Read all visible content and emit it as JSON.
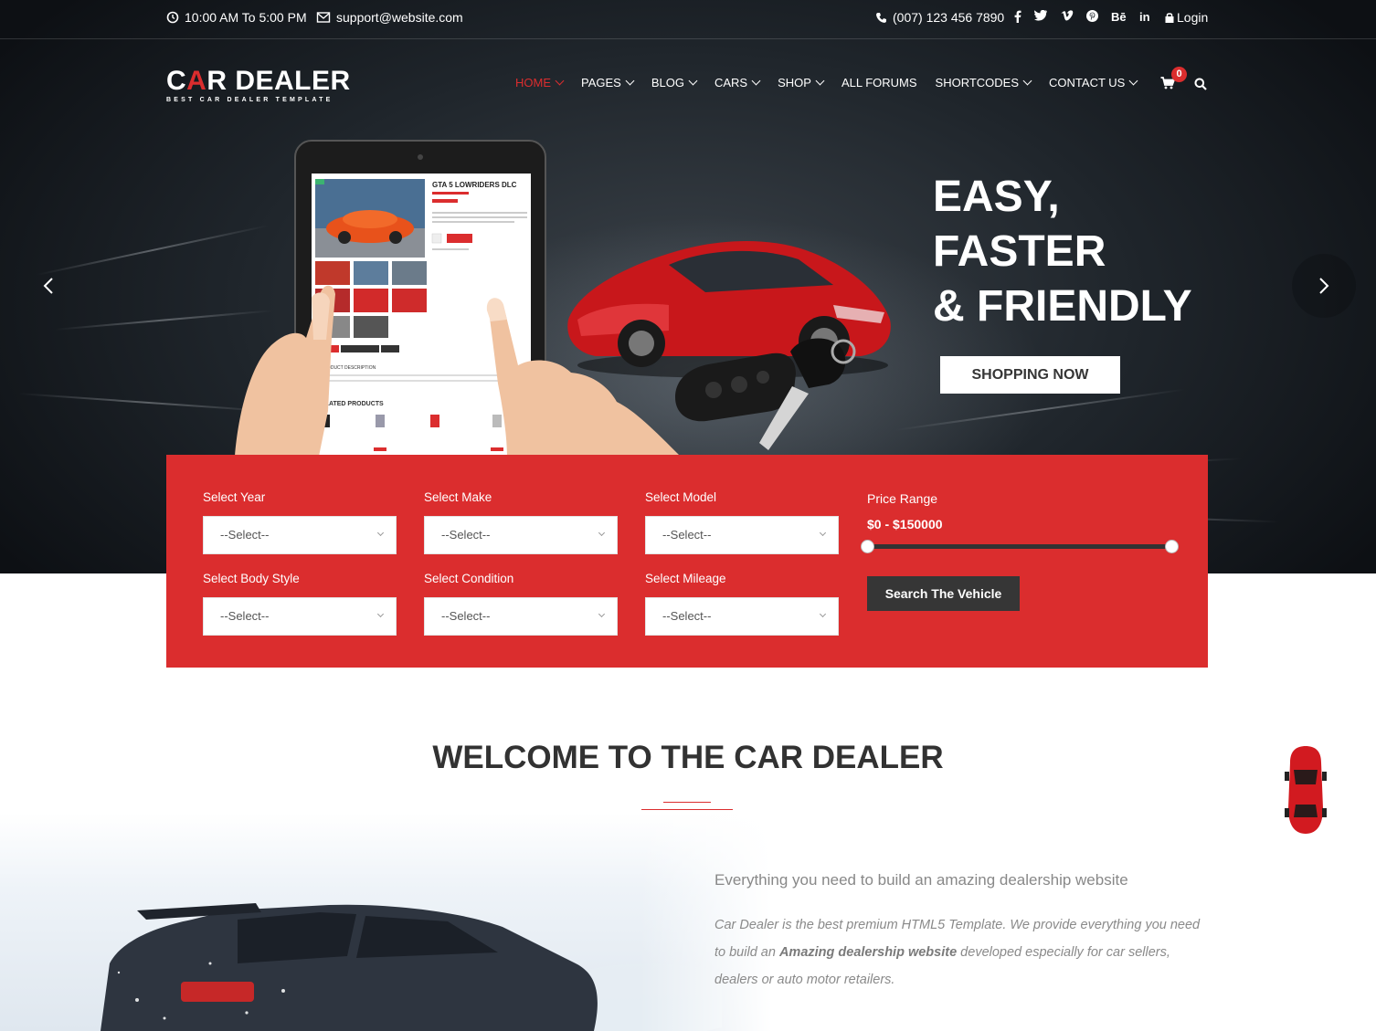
{
  "topbar": {
    "hours": "10:00 AM To 5:00 PM",
    "email": "support@website.com",
    "phone": "(007) 123 456 7890",
    "social_icons": [
      "facebook-icon",
      "twitter-icon",
      "vimeo-icon",
      "pinterest-icon",
      "behance-icon",
      "linkedin-icon"
    ],
    "behance_text": "Bē",
    "linkedin_text": "in",
    "login": "Login"
  },
  "logo": {
    "word_left": "C",
    "word_accent": "A",
    "word_mid": "R DEALER",
    "tagline": "BEST CAR DEALER TEMPLATE"
  },
  "nav": {
    "items": [
      {
        "label": "HOME",
        "active": true,
        "dropdown": true
      },
      {
        "label": "PAGES",
        "dropdown": true
      },
      {
        "label": "BLOG",
        "dropdown": true
      },
      {
        "label": "CARS",
        "dropdown": true
      },
      {
        "label": "SHOP",
        "dropdown": true
      },
      {
        "label": "ALL FORUMS",
        "dropdown": false
      },
      {
        "label": "SHORTCODES",
        "dropdown": true
      },
      {
        "label": "CONTACT US",
        "dropdown": true
      }
    ],
    "cart_count": "0"
  },
  "hero": {
    "headline": [
      "EASY,",
      "FASTER",
      "& FRIENDLY"
    ],
    "button": "SHOPPING NOW",
    "tablet": {
      "product_title": "GTA 5 LOWRIDERS DLC",
      "description_heading": "PRODUCT DESCRIPTION",
      "related_heading": "ELATED PRODUCTS"
    }
  },
  "search": {
    "fields": [
      {
        "label": "Select Year",
        "value": "--Select--"
      },
      {
        "label": "Select Make",
        "value": "--Select--"
      },
      {
        "label": "Select Model",
        "value": "--Select--"
      },
      {
        "label": "Select Body Style",
        "value": "--Select--"
      },
      {
        "label": "Select Condition",
        "value": "--Select--"
      },
      {
        "label": "Select Mileage",
        "value": "--Select--"
      }
    ],
    "price_label": "Price Range",
    "price_value": "$0 - $150000",
    "price_min_fraction": 0,
    "price_max_fraction": 1,
    "button": "Search The Vehicle"
  },
  "welcome": {
    "title": "WELCOME TO THE CAR DEALER",
    "subtitle": "Everything you need to build an amazing dealership website",
    "para_1": "Car Dealer is the best premium HTML5 Template. We provide everything you need to build an ",
    "para_bold": "Amazing dealership website",
    "para_2": " developed especially for car sellers, dealers or auto motor retailers."
  },
  "colors": {
    "accent": "#db2d2e",
    "dark": "#363636"
  }
}
